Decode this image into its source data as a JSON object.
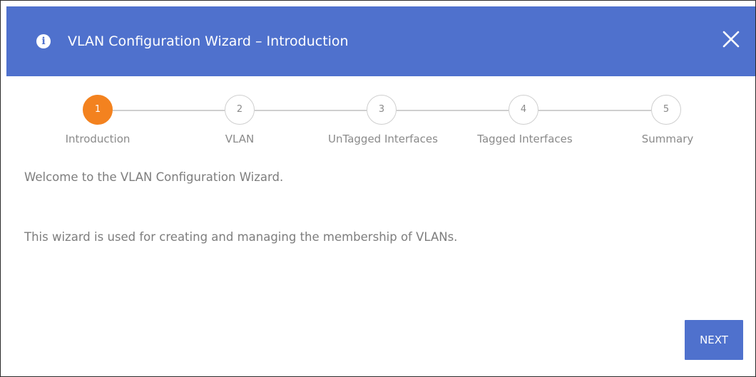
{
  "dialog": {
    "title": "VLAN Configuration Wizard – Introduction",
    "info_icon": "info-circle-icon",
    "close_icon": "close-x-icon"
  },
  "stepper": {
    "current_step": 1,
    "steps": [
      {
        "number": "1",
        "label": "Introduction"
      },
      {
        "number": "2",
        "label": "VLAN"
      },
      {
        "number": "3",
        "label": "UnTagged Interfaces"
      },
      {
        "number": "4",
        "label": "Tagged Interfaces"
      },
      {
        "number": "5",
        "label": "Summary"
      }
    ]
  },
  "content": {
    "welcome": "Welcome to the VLAN Configuration Wizard.",
    "description": "This wizard is used for creating and managing the membership of VLANs."
  },
  "actions": {
    "next_label": "NEXT"
  },
  "colors": {
    "header": "#4f71cd",
    "active_step": "#f3821f",
    "inactive_step_border": "#cfcfcf",
    "text_gray": "#7d7d7d"
  }
}
